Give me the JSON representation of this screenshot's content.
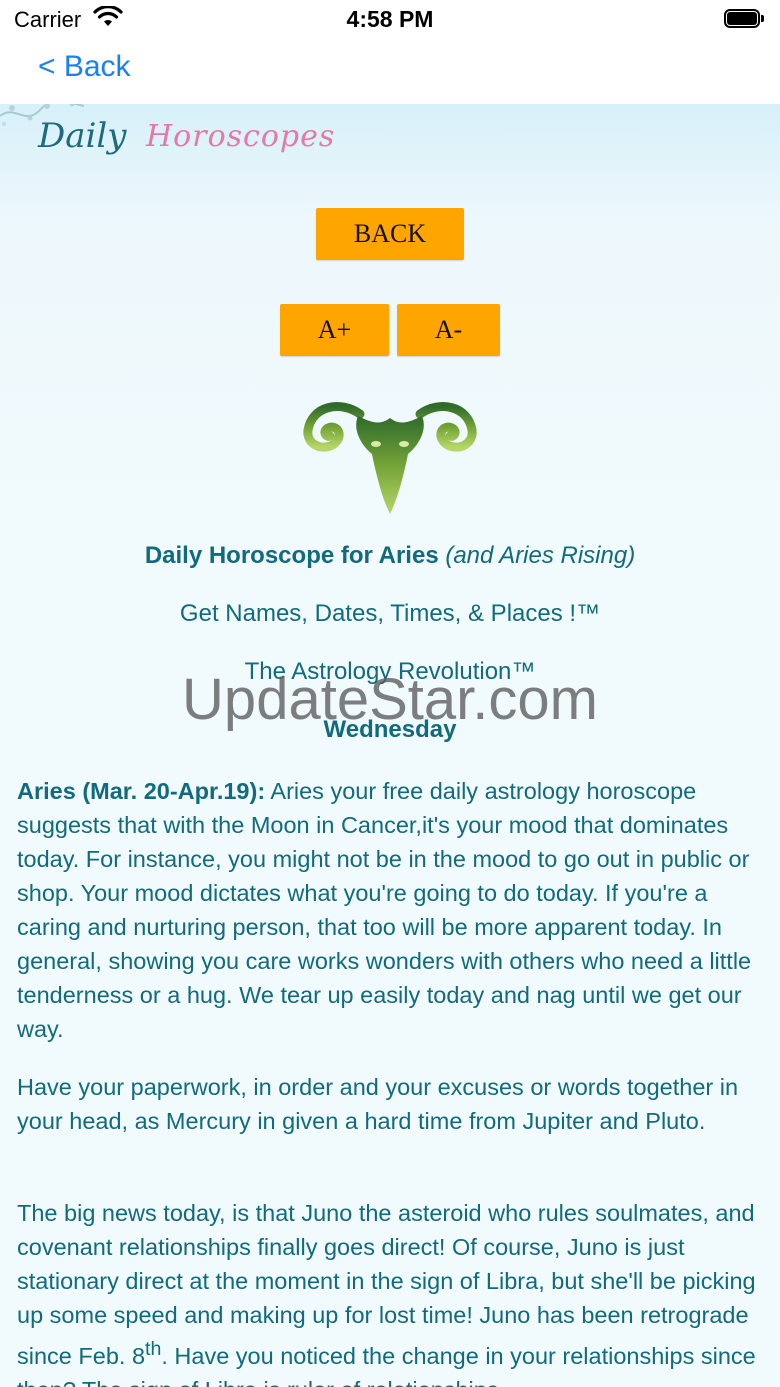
{
  "status_bar": {
    "carrier": "Carrier",
    "time": "4:58 PM"
  },
  "nav": {
    "back_label": "< Back"
  },
  "header": {
    "logo_word1": "Daily",
    "logo_word2": "Horoscopes"
  },
  "buttons": {
    "back": "BACK",
    "font_increase": "A+",
    "font_decrease": "A-"
  },
  "sign_icon": "aries-ram-icon",
  "title": {
    "main": "Daily Horoscope for Aries",
    "sub": "(and Aries Rising)"
  },
  "tagline1": "Get Names, Dates, Times, & Places !™",
  "tagline2": "The Astrology Revolution™",
  "day": "Wednesday",
  "watermark": "UpdateStar.com",
  "paragraphs": {
    "p1_lead": "Aries (Mar. 20-Apr.19):",
    "p1_body": " Aries your free daily astrology horoscope suggests that with the Moon in Cancer,it's your mood that dominates today. For instance, you might not be in the mood to go out in public or shop.  Your mood dictates what you're going to do today.  If you're a caring and nurturing person, that too will be more apparent today. In general, showing you care works wonders with others who need a little tenderness or a hug.  We tear up easily today and nag until we get our way.",
    "p2": "Have your paperwork, in order and your excuses or words together in your head, as Mercury in given a hard time from Jupiter and Pluto.",
    "p3_a": "The big news today, is that Juno the asteroid who rules soulmates, and covenant relationships finally goes direct!  Of course, Juno is just stationary direct at the moment in the sign of Libra, but she'll be picking up some speed and making up for lost time!  Juno has been retrograde since Feb. 8",
    "p3_sup": "th",
    "p3_b": ".  Have you noticed the change in your relationships since then?  The sign of Libra is ruler of relationships"
  },
  "colors": {
    "accent_button": "#ffa500",
    "text_teal": "#116b7c",
    "ios_blue": "#1a7ff5",
    "background": "#edf8fc"
  }
}
